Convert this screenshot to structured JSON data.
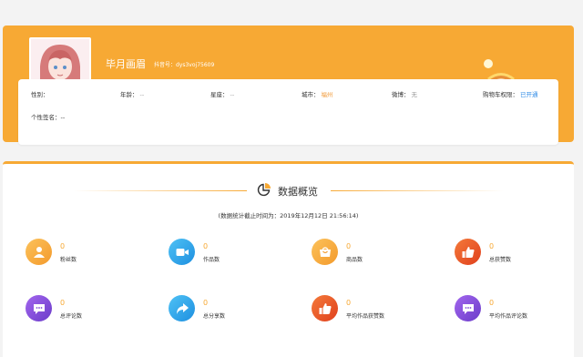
{
  "profile": {
    "nickname": "毕月画眉",
    "douyin_id": "抖音号：dys3voj75609",
    "fields": [
      {
        "label": "性别：",
        "value": ""
      },
      {
        "label": "年龄：",
        "value": "--"
      },
      {
        "label": "星座：",
        "value": "--"
      },
      {
        "label": "城市：",
        "value": "福州"
      },
      {
        "label": "微博：",
        "value": "无"
      },
      {
        "label": "购物车权限：",
        "value": "已开通"
      }
    ],
    "signature": "个性签名：--"
  },
  "overview": {
    "title": "数据概览",
    "note": "(数据统计截止时间为：2019年12月12日 21:56:14)",
    "stats": [
      {
        "label": "粉丝数",
        "value": "0",
        "icon": "user-icon",
        "color": "#f7a934"
      },
      {
        "label": "作品数",
        "value": "0",
        "icon": "video-icon",
        "color": "#2ea7e8"
      },
      {
        "label": "商品数",
        "value": "0",
        "icon": "shop-icon",
        "color": "#f7a934"
      },
      {
        "label": "总获赞数",
        "value": "0",
        "icon": "thumbs-up-icon",
        "color": "#ea5425"
      },
      {
        "label": "总评论数",
        "value": "0",
        "icon": "comment-icon",
        "color": "#8a4fd8"
      },
      {
        "label": "总分享数",
        "value": "0",
        "icon": "share-icon",
        "color": "#2ea7e8"
      },
      {
        "label": "平均作品获赞数",
        "value": "0",
        "icon": "thumbs-up-icon",
        "color": "#ea5425"
      },
      {
        "label": "平均作品评论数",
        "value": "0",
        "icon": "comment-icon",
        "color": "#8a4fd8"
      }
    ]
  }
}
